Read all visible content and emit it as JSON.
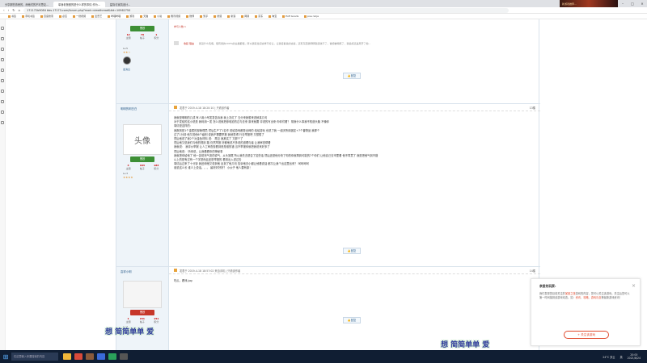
{
  "browser": {
    "tabs": [
      {
        "label": "分享那些熟悉的，而他们的不可思议..."
      },
      {
        "label": "单身老爸做的是什么样的事情,作为..."
      },
      {
        "label": "星际与家具设计..."
      }
    ],
    "thumbnail_label": "新游戏推荐...",
    "url": "171172b9084  bbs.17173.com/forum.php?mod=viewthread&tid=10962750",
    "bookmarks": [
      "书签",
      "手机书签",
      "百度搜索",
      "必应",
      "一搜视频",
      "爱奇艺",
      "哔哩哔哩",
      "游戏",
      "天猫",
      "小说",
      "腾讯视频",
      "微博",
      "知乎",
      "搜狐",
      "新浪",
      "网易",
      "京东",
      "淘宝",
      "PoE Goods",
      "poe ninja"
    ]
  },
  "posts": [
    {
      "author": "",
      "rank": "黑铁",
      "stats": [
        {
          "value": "12",
          "label": "主题"
        },
        {
          "value": "79",
          "label": "帖子"
        },
        {
          "value": "1",
          "label": "积分"
        }
      ],
      "level": "Lv.5",
      "send_message": "发消息",
      "reward_label": "参与人数 1",
      "reward_text": "我没什么毛病，很有用的100%的主播都懂，所以我就当初这样不好让，让我接着说的这些，还有东西我明明就接收不了，谁想被嘲笑了，我最终还是离开了他...",
      "reward_note": "收起 理由",
      "like_label": "回复"
    },
    {
      "author": "明明的明白白",
      "meta": "发表于 2019-4-18 18:20:10  |  只看该作者",
      "floor": "13楼",
      "avatar_text": "头像",
      "rank": "黑铁",
      "stats": [
        {
          "value": "4",
          "label": "主题"
        },
        {
          "value": "183",
          "label": "帖子"
        },
        {
          "value": "183",
          "label": "积分"
        }
      ],
      "level": "Lv.3",
      "send_message": "发消息",
      "lines": [
        "我就是明明的几成 有人用小号发发告诉我 我上次红了 五分来我想来说就真几句",
        "对于发给的这小说是 我利用一发 怎么说就把参电影的过与去来 原来就要 评说的写出来 你你们看？ 常我什么事我不知道头脑 不懂你",
        "事情是这样的：",
        "我报到是1个金属的部管理员 然后生产了1名作 说给游戏都是全网的 给给游玩 也说了我 一组天所用固定+7个普物品 我那个",
        "过了1分钟 他又说他6个级别 说我不需要举报 我就觉得 行去举报吧 又想想了",
        "然后他说了我2个对金色材料 说：  再见    我其实了  又那个了",
        "然后他又说我们与他的规则 路 仍然举报 好都他说不多说的道理与者 让我审查帮看",
        "我就说：  我评价举报  让人工审查查看到底是谁的错  当不举报你就把我说来好多了",
        "然后他说：  听你说，让我看看你的神秘事",
        "我就把你给他了  他一劲说完气流的说气，从头到尾 所以我先去是否了这些话 然后还是他分析了你的你就再到可能的7个你们 让他自己去市里看 他不同意了 我是把他气到不错",
        "以上的是有过有一个字是而且还是举报的 看到出入说过去",
        "事情后过来了十分钟 我还和他又说到他 反到了他几句 告诉他去小都让他看说话  都又让我个出这里出来？  呵呵呵呵",
        "谁说这么长  谁少上说话。。。  最好好好好？ 小伙子  他人要有原！"
      ],
      "like_label": "回复"
    },
    {
      "author": "嘉祥小明",
      "meta": "发表于 2019-4-18 18:57:02  来自手机  |  只看该作者",
      "floor": "14楼",
      "rank": "黑铁",
      "stats": [
        {
          "value": "1",
          "label": "主题"
        },
        {
          "value": "151",
          "label": "帖子"
        },
        {
          "value": "151",
          "label": "积分"
        }
      ],
      "level": "Lv.3",
      "lines": [
        "吃瓜，看戏.jpg"
      ],
      "like_label": "回复"
    }
  ],
  "popup": {
    "title": "亲爱的玩家:",
    "text_parts": [
      "我们发现您目前关注的",
      "某某之旅",
      "游戏的内容，您可以关注该游戏。关注后您可以第一时间接到该游戏动态。如：",
      "资讯",
      "、",
      "攻略",
      "、",
      "游戏礼包",
      "等最新游戏资讯！"
    ],
    "close": "×",
    "follow_button": "+ 关注该游戏"
  },
  "subtitles": [
    "想 简简单单 爱",
    "想 简简单单 爱"
  ],
  "taskbar": {
    "search_placeholder": "在这里输入你要搜索的内容",
    "weather": "24°C 多云",
    "lang": "英",
    "time": "20:00",
    "date": "2021/8/24"
  },
  "colors": {
    "accent": "#2b5d8b",
    "rank_green": "#3d8f35",
    "rank_red": "#c6372a",
    "highlight": "#e0482b",
    "subtitle": "#2f3a9c"
  }
}
